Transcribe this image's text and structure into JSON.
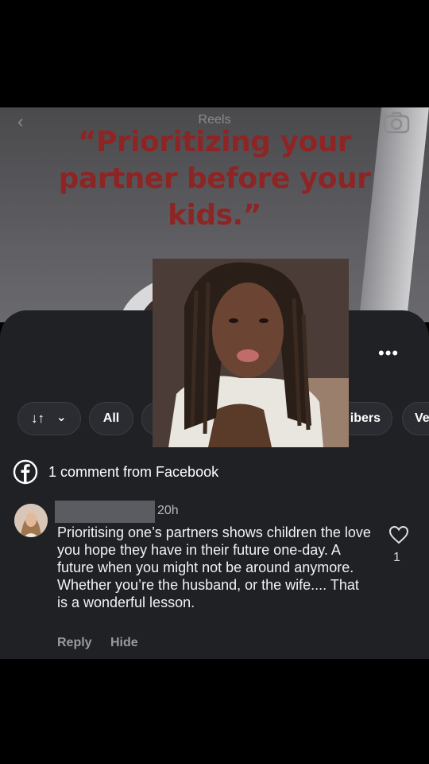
{
  "reel": {
    "title": "Reels",
    "headline": "“Prioritizing your partner before your kids.”"
  },
  "sheet": {
    "more_icon": "more-horizontal-icon",
    "filters": {
      "sort_icon": "sort-icon",
      "all_label": "All",
      "subscribers_label": "ibers",
      "ve_label": "Ve"
    },
    "facebook_label": "1 comment from Facebook",
    "comment": {
      "time": "20h",
      "text": "Prioritising one’s partners shows children the love you hope they have in their future one-day. A future when you might not be around anymore. Whether you’re the husband, or the wife.... That is a wonderful lesson.",
      "reply_label": "Reply",
      "hide_label": "Hide",
      "like_count": "1"
    }
  },
  "colors": {
    "headline": "#8e2525",
    "sheet_bg": "#1f2125",
    "chip_bg": "#2a2c31"
  }
}
